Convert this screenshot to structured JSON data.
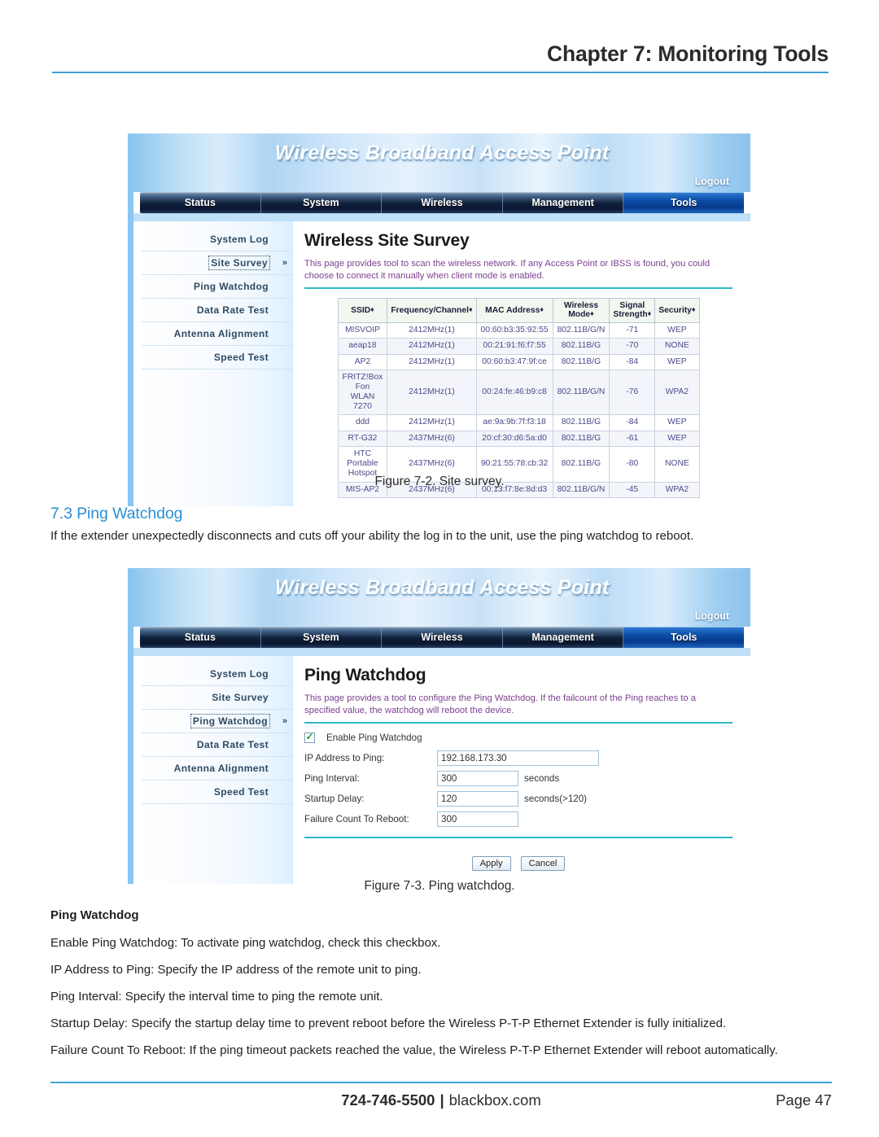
{
  "header": {
    "chapter_title": "Chapter 7: Monitoring Tools"
  },
  "router_ui": {
    "brand": "Wireless Broadband Access Point",
    "logout_label": "Logout",
    "nav_tabs": [
      {
        "label": "Status",
        "active": false
      },
      {
        "label": "System",
        "active": false
      },
      {
        "label": "Wireless",
        "active": false
      },
      {
        "label": "Management",
        "active": false
      },
      {
        "label": "Tools",
        "active": true
      }
    ],
    "sidebar_items": [
      "System Log",
      "Site Survey",
      "Ping Watchdog",
      "Data Rate Test",
      "Antenna Alignment",
      "Speed Test"
    ],
    "selected_marker": "»"
  },
  "figure1": {
    "page_title": "Wireless Site Survey",
    "description": "This page provides tool to scan the wireless network. If any Access Point or IBSS is found, you could choose to connect it manually when client mode is enabled.",
    "selected_sidebar": "Site Survey",
    "caption": "Figure 7-2. Site survey.",
    "table": {
      "columns": [
        {
          "label": "SSID",
          "sortable": true
        },
        {
          "label": "Frequency/Channel",
          "sortable": true
        },
        {
          "label": "MAC Address",
          "sortable": true
        },
        {
          "label": "Wireless Mode",
          "sortable": true
        },
        {
          "label": "Signal Strength",
          "sortable": true
        },
        {
          "label": "Security",
          "sortable": true
        }
      ],
      "sort_glyph": "♦",
      "rows": [
        {
          "ssid": "MISVOIP",
          "freq": "2412MHz(1)",
          "mac": "00:60:b3:35:92:55",
          "mode": "802.11B/G/N",
          "signal": "-71",
          "security": "WEP"
        },
        {
          "ssid": "aeap18",
          "freq": "2412MHz(1)",
          "mac": "00:21:91:f6:f7:55",
          "mode": "802.11B/G",
          "signal": "-70",
          "security": "NONE"
        },
        {
          "ssid": "AP2",
          "freq": "2412MHz(1)",
          "mac": "00:60:b3:47:9f:ce",
          "mode": "802.11B/G",
          "signal": "-84",
          "security": "WEP"
        },
        {
          "ssid": "FRITZ!Box Fon WLAN 7270",
          "freq": "2412MHz(1)",
          "mac": "00:24:fe:46:b9:c8",
          "mode": "802.11B/G/N",
          "signal": "-76",
          "security": "WPA2"
        },
        {
          "ssid": "ddd",
          "freq": "2412MHz(1)",
          "mac": "ae:9a:9b:7f:f3:18",
          "mode": "802.11B/G",
          "signal": "-84",
          "security": "WEP"
        },
        {
          "ssid": "RT-G32",
          "freq": "2437MHz(6)",
          "mac": "20:cf:30:d6:5a:d0",
          "mode": "802.11B/G",
          "signal": "-61",
          "security": "WEP"
        },
        {
          "ssid": "HTC Portable Hotspot",
          "freq": "2437MHz(6)",
          "mac": "90:21:55:78:cb:32",
          "mode": "802.11B/G",
          "signal": "-80",
          "security": "NONE"
        },
        {
          "ssid": "MIS-AP2",
          "freq": "2437MHz(6)",
          "mac": "00:13:f7:8e:8d:d3",
          "mode": "802.11B/G/N",
          "signal": "-45",
          "security": "WPA2"
        }
      ]
    }
  },
  "section": {
    "number_title": "7.3 Ping Watchdog",
    "intro": "If the extender unexpectedly disconnects and cuts off your ability the log in to the unit, use the ping watchdog to reboot."
  },
  "figure2": {
    "page_title": "Ping Watchdog",
    "description": "This page provides a tool to configure the Ping Watchdog. If the failcount of the Ping reaches to a specified value, the watchdog will reboot the device.",
    "selected_sidebar": "Ping Watchdog",
    "caption": "Figure 7-3. Ping watchdog.",
    "form": {
      "enable_label": "Enable Ping Watchdog",
      "enable_checked": true,
      "check_glyph": "✓",
      "fields": [
        {
          "label": "IP Address to Ping:",
          "value": "192.168.173.30",
          "unit": "",
          "size": "ip"
        },
        {
          "label": "Ping Interval:",
          "value": "300",
          "unit": "seconds",
          "size": "num"
        },
        {
          "label": "Startup Delay:",
          "value": "120",
          "unit": "seconds(>120)",
          "size": "num"
        },
        {
          "label": "Failure Count To Reboot:",
          "value": "300",
          "unit": "",
          "size": "num"
        }
      ],
      "apply_label": "Apply",
      "cancel_label": "Cancel"
    }
  },
  "descriptions": {
    "heading": "Ping Watchdog",
    "items": [
      "Enable Ping Watchdog: To activate ping watchdog, check this checkbox.",
      "IP Address to Ping: Specify the IP address of the remote unit to ping.",
      "Ping Interval: Specify the interval time to ping the remote unit.",
      "Startup Delay: Specify the startup delay time to prevent reboot before the Wireless P-T-P Ethernet Extender is fully initialized.",
      "Failure Count To Reboot: If the ping timeout packets reached the value, the Wireless P-T-P Ethernet Extender will reboot automatically."
    ]
  },
  "footer": {
    "phone": "724-746-5500",
    "separator": "|",
    "website": "blackbox.com",
    "page_label": "Page 47"
  },
  "colors": {
    "accent_blue": "#3f9fd6",
    "heading_blue": "#2b8fd4",
    "teal_rule": "#2fb8c4",
    "nav_active": "#0d4ea8",
    "desc_purple": "#7d3f8f"
  }
}
